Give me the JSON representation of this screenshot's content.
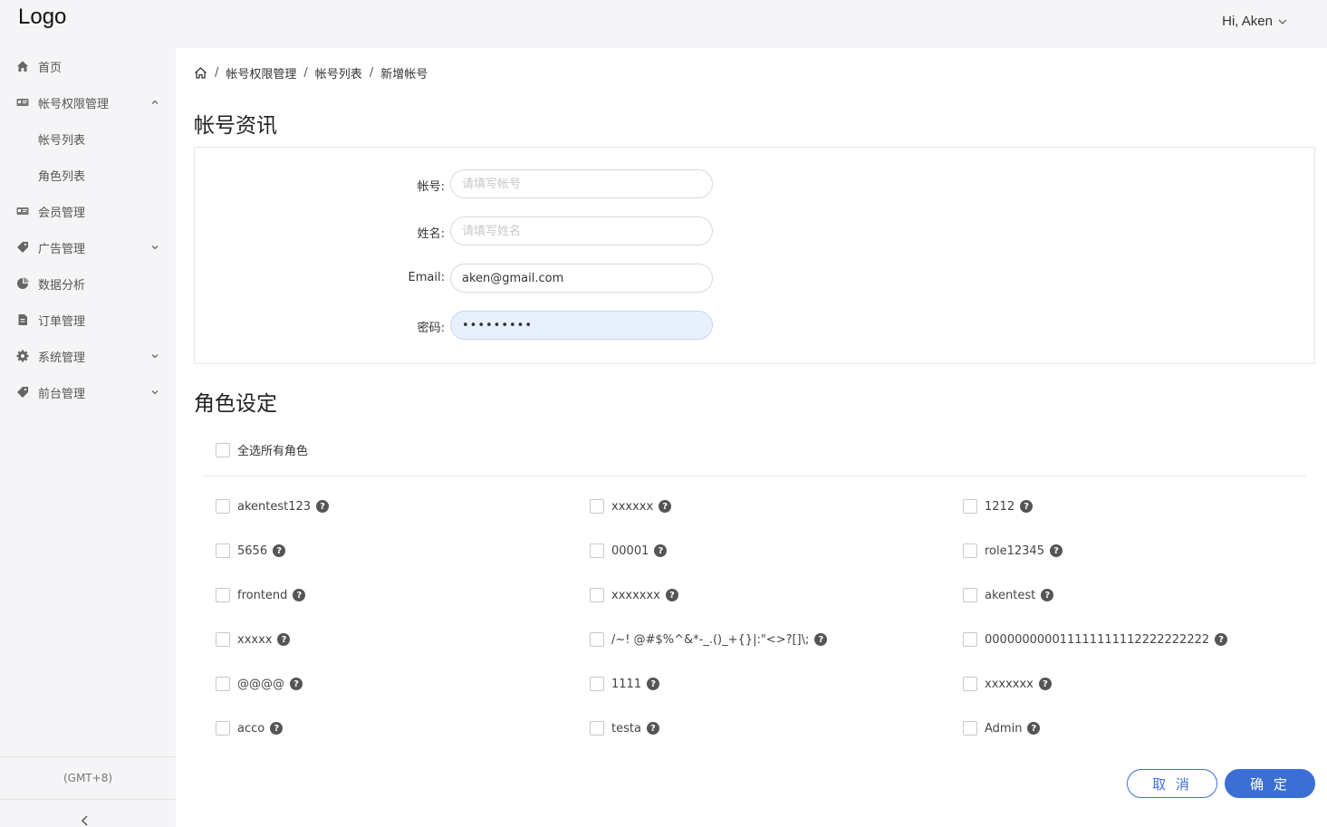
{
  "header": {
    "logo": "Logo",
    "user": "Hi, Aken"
  },
  "sidebar": {
    "items": [
      {
        "label": "首页",
        "icon": "home-icon"
      },
      {
        "label": "帐号权限管理",
        "icon": "id-card-icon",
        "expanded": true
      },
      {
        "label": "帐号列表"
      },
      {
        "label": "角色列表"
      },
      {
        "label": "会员管理",
        "icon": "id-card-icon"
      },
      {
        "label": "广告管理",
        "icon": "tag-icon"
      },
      {
        "label": "数据分析",
        "icon": "pie-chart-icon"
      },
      {
        "label": "订单管理",
        "icon": "document-icon"
      },
      {
        "label": "系统管理",
        "icon": "gear-icon"
      },
      {
        "label": "前台管理",
        "icon": "tag-icon"
      }
    ],
    "timezone": "(GMT+8)"
  },
  "breadcrumb": {
    "items": [
      "帐号权限管理",
      "帐号列表",
      "新增帐号"
    ],
    "sep": "/"
  },
  "account": {
    "title": "帐号资讯",
    "fields": [
      {
        "label": "帐号:",
        "value": "",
        "placeholder": "请填写帐号"
      },
      {
        "label": "姓名:",
        "value": "",
        "placeholder": "请填写姓名"
      },
      {
        "label": "Email:",
        "value": "aken@gmail.com",
        "placeholder": ""
      },
      {
        "label": "密码:",
        "value": "•••••••••",
        "placeholder": ""
      }
    ]
  },
  "roles": {
    "title": "角色设定",
    "select_all": "全选所有角色",
    "items": [
      "akentest123",
      "xxxxxx",
      "1212",
      "5656",
      "00001",
      "role12345",
      "frontend",
      "xxxxxxx",
      "akentest",
      "xxxxx",
      "/~! @#$%^&*-_.()_+{}|:\"<>?[]\\;",
      "000000000011111111112222222222",
      "@@@@",
      "1111",
      "xxxxxxx",
      "acco",
      "testa",
      "Admin"
    ]
  },
  "actions": {
    "cancel": "取 消",
    "ok": "确 定"
  },
  "colors": {
    "primary": "#3b6fd6",
    "sidebar_bg": "#f5f5f7",
    "password_bg": "#e8f0fe"
  }
}
